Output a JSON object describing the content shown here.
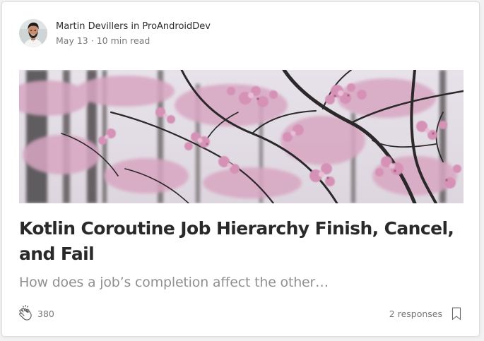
{
  "post": {
    "author": "Martin Devillers",
    "in_word": "in",
    "publication": "ProAndroidDev",
    "date": "May 13",
    "separator": "·",
    "read_time": "10 min read",
    "title": "Kotlin Coroutine Job Hierarchy Finish, Cancel, and Fail",
    "subtitle": "How does a job’s completion affect the other…"
  },
  "footer": {
    "clap_count": "380",
    "responses_label": "2 responses"
  },
  "icons": {
    "avatar": "author-avatar",
    "clap": "clap-icon",
    "bookmark": "bookmark-icon"
  },
  "colors": {
    "blossom": "#d8a2bf",
    "sky": "#e9e4ec",
    "trunk": "#2c2a2b"
  }
}
